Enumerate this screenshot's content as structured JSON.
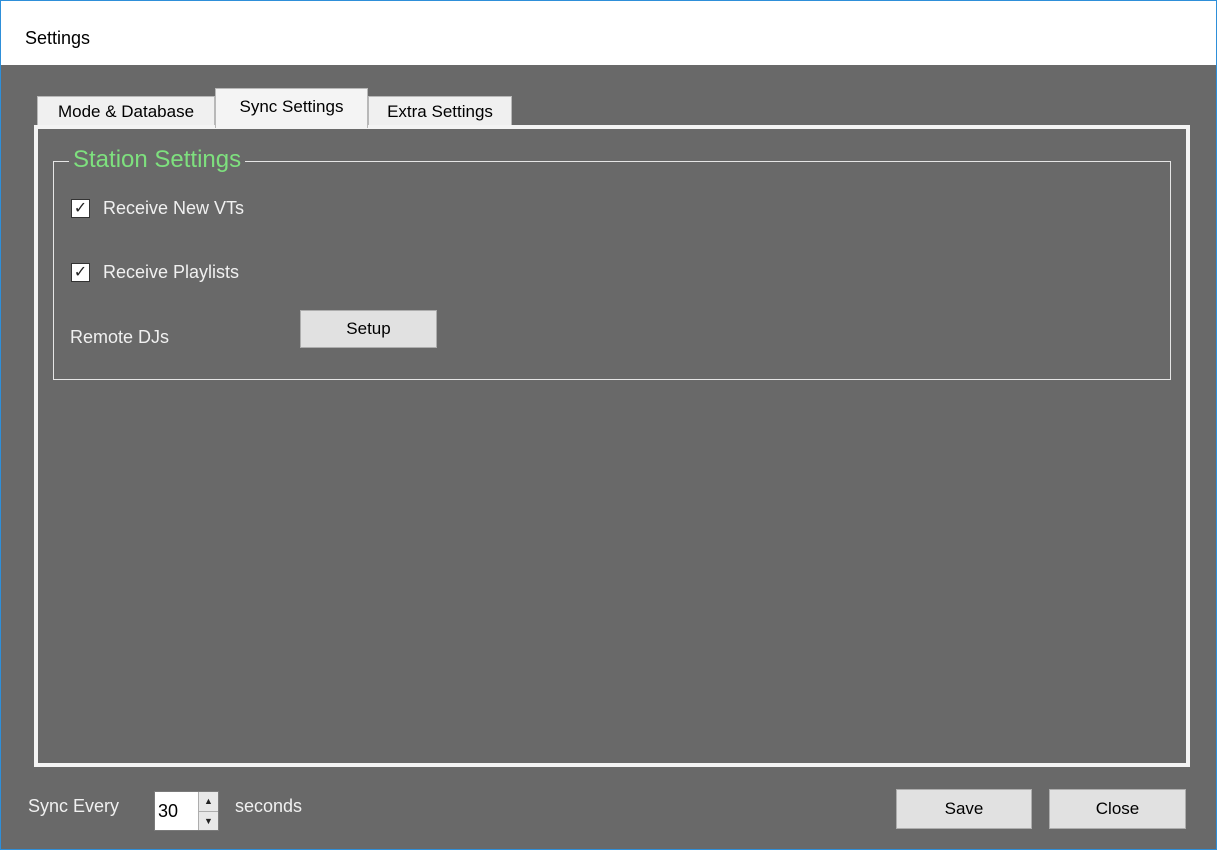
{
  "window": {
    "title": "Settings"
  },
  "tabs": [
    {
      "label": "Mode & Database"
    },
    {
      "label": "Sync Settings",
      "selected": true
    },
    {
      "label": "Extra Settings"
    }
  ],
  "station": {
    "legend": "Station Settings",
    "receive_vts": {
      "label": "Receive New VTs",
      "checked": true
    },
    "receive_playlists": {
      "label": "Receive Playlists",
      "checked": true
    },
    "remote_djs_label": "Remote DJs",
    "setup_label": "Setup"
  },
  "footer": {
    "sync_every_label": "Sync Every",
    "interval_value": "30",
    "seconds_label": "seconds",
    "save_label": "Save",
    "close_label": "Close"
  },
  "colors": {
    "legend": "#7ee07e",
    "background": "#696969",
    "accent_border": "#2e8fd9"
  },
  "icons": {
    "check": "checkmark-icon",
    "up": "spin-up-icon",
    "down": "spin-down-icon"
  }
}
